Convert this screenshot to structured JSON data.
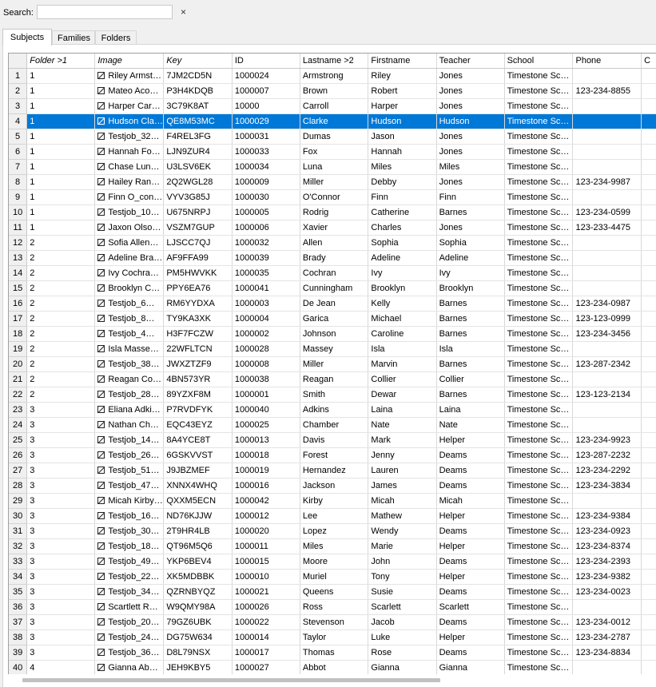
{
  "search": {
    "label": "Search:",
    "value": "",
    "placeholder": "",
    "clear_icon": "×"
  },
  "tabs": [
    {
      "label": "Subjects",
      "active": true
    },
    {
      "label": "Families",
      "active": false
    },
    {
      "label": "Folders",
      "active": false
    }
  ],
  "columns": [
    "Folder >1",
    "Image",
    "Key",
    "ID",
    "Lastname >2",
    "Firstname",
    "Teacher",
    "School",
    "Phone",
    "C"
  ],
  "italic_columns": [
    0,
    1,
    2
  ],
  "selected_row": 4,
  "colors": {
    "selection": "#0078d7"
  },
  "rows": [
    [
      "1",
      "Riley Armst…",
      "7JM2CD5N",
      "1000024",
      "Armstrong",
      "Riley",
      "Jones",
      "Timestone Sc…",
      ""
    ],
    [
      "1",
      "Mateo Aco…",
      "P3H4KDQB",
      "1000007",
      "Brown",
      "Robert",
      "Jones",
      "Timestone Sc…",
      "123-234-8855"
    ],
    [
      "1",
      "Harper Car…",
      "3C79K8AT",
      "10000",
      "Carroll",
      "Harper",
      "Jones",
      "Timestone Sc…",
      ""
    ],
    [
      "1",
      "Hudson Cla…",
      "QE8M53MC",
      "1000029",
      "Clarke",
      "Hudson",
      "Hudson",
      "Timestone Sc…",
      ""
    ],
    [
      "1",
      "Testjob_32…",
      "F4REL3FG",
      "1000031",
      "Dumas",
      "Jason",
      "Jones",
      "Timestone Sc…",
      ""
    ],
    [
      "1",
      "Hannah Fo…",
      "LJN9ZUR4",
      "1000033",
      "Fox",
      "Hannah",
      "Jones",
      "Timestone Sc…",
      ""
    ],
    [
      "1",
      "Chase Lun…",
      "U3LSV6EK",
      "1000034",
      "Luna",
      "Miles",
      "Miles",
      "Timestone Sc…",
      ""
    ],
    [
      "1",
      "Hailey Ran…",
      "2Q2WGL28",
      "1000009",
      "Miller",
      "Debby",
      "Jones",
      "Timestone Sc…",
      "123-234-9987"
    ],
    [
      "1",
      "Finn O_con…",
      "VYV3G85J",
      "1000030",
      "O'Connor",
      "Finn",
      "Finn",
      "Timestone Sc…",
      ""
    ],
    [
      "1",
      "Testjob_10…",
      "U675NRPJ",
      "1000005",
      "Rodrig",
      "Catherine",
      " Barnes",
      "Timestone Sc…",
      "123-234-0599"
    ],
    [
      "1",
      "Jaxon Olso…",
      "VSZM7GUP",
      "1000006",
      "Xavier",
      "Charles",
      "Jones",
      "Timestone Sc…",
      "123-233-4475"
    ],
    [
      "2",
      "Sofia Allen…",
      "LJSCC7QJ",
      "1000032",
      "Allen",
      "Sophia",
      "Sophia",
      "Timestone Sc…",
      ""
    ],
    [
      "2",
      "Adeline Bra…",
      "AF9FFA99",
      "1000039",
      "Brady",
      "Adeline",
      "Adeline",
      "Timestone Sc…",
      ""
    ],
    [
      "2",
      "Ivy Cochra…",
      "PM5HWVKK",
      "1000035",
      "Cochran",
      "Ivy",
      "Ivy",
      "Timestone Sc…",
      ""
    ],
    [
      "2",
      "Brooklyn C…",
      "PPY6EA76",
      "1000041",
      "Cunningham",
      "Brooklyn",
      "Brooklyn",
      "Timestone Sc…",
      ""
    ],
    [
      "2",
      "Testjob_6…",
      "RM6YYDXA",
      "1000003",
      "De Jean",
      "Kelly",
      " Barnes",
      "Timestone Sc…",
      "123-234-0987"
    ],
    [
      "2",
      "Testjob_8…",
      "TY9KA3XK",
      "1000004",
      "Garica",
      "Michael",
      " Barnes",
      "Timestone Sc…",
      "123-123-0999"
    ],
    [
      "2",
      "Testjob_4…",
      "H3F7FCZW",
      "1000002",
      "Johnson",
      "Caroline",
      " Barnes",
      "Timestone Sc…",
      "123-234-3456"
    ],
    [
      "2",
      "Isla Masse…",
      "22WFLTCN",
      "1000028",
      "Massey",
      "Isla",
      "Isla",
      "Timestone Sc…",
      ""
    ],
    [
      "2",
      "Testjob_38…",
      "JWXZTZF9",
      "1000008",
      "Miller",
      "Marvin",
      " Barnes",
      "Timestone Sc…",
      "123-287-2342"
    ],
    [
      "2",
      "Reagan Co…",
      "4BN573YR",
      "1000038",
      "Reagan",
      "Collier",
      "Collier",
      "Timestone Sc…",
      ""
    ],
    [
      "2",
      "Testjob_28…",
      "89YZXF8M",
      "1000001",
      "Smith",
      "Dewar",
      " Barnes",
      "Timestone Sc…",
      "123-123-2134"
    ],
    [
      "3",
      "Eliana Adki…",
      "P7RVDFYK",
      "1000040",
      "Adkins",
      "Laina",
      "Laina",
      "Timestone Sc…",
      ""
    ],
    [
      "3",
      "Nathan Ch…",
      "EQC43EYZ",
      "1000025",
      "Chamber",
      "Nate",
      "Nate",
      "Timestone Sc…",
      ""
    ],
    [
      "3",
      "Testjob_14…",
      "8A4YCE8T",
      "1000013",
      "Davis",
      "Mark",
      "Helper",
      "Timestone Sc…",
      "123-234-9923"
    ],
    [
      "3",
      "Testjob_26…",
      "6GSKVVST",
      "1000018",
      "Forest",
      "Jenny",
      "Deams",
      "Timestone Sc…",
      "123-287-2232"
    ],
    [
      "3",
      "Testjob_51…",
      "J9JBZMEF",
      "1000019",
      "Hernandez",
      "Lauren",
      "Deams",
      "Timestone Sc…",
      "123-234-2292"
    ],
    [
      "3",
      "Testjob_47…",
      "XNNX4WHQ",
      "1000016",
      "Jackson",
      "James",
      "Deams",
      "Timestone Sc…",
      "123-234-3834"
    ],
    [
      "3",
      "Micah Kirby…",
      "QXXM5ECN",
      "1000042",
      "Kirby",
      "Micah",
      "Micah",
      "Timestone Sc…",
      ""
    ],
    [
      "3",
      "Testjob_16…",
      "ND76KJJW",
      "1000012",
      "Lee",
      "Mathew",
      "Helper",
      "Timestone Sc…",
      "123-234-9384"
    ],
    [
      "3",
      "Testjob_30…",
      "2T9HR4LB",
      "1000020",
      "Lopez",
      "Wendy",
      "Deams",
      "Timestone Sc…",
      "123-234-0923"
    ],
    [
      "3",
      "Testjob_18…",
      "QT96M5Q6",
      "1000011",
      "Miles",
      "Marie",
      "Helper",
      "Timestone Sc…",
      "123-234-8374"
    ],
    [
      "3",
      "Testjob_49…",
      "YKP6BEV4",
      "1000015",
      "Moore",
      "John",
      "Deams",
      "Timestone Sc…",
      "123-234-2393"
    ],
    [
      "3",
      "Testjob_22…",
      "XK5MDBBK",
      "1000010",
      "Muriel",
      "Tony",
      "Helper",
      "Timestone Sc…",
      "123-234-9382"
    ],
    [
      "3",
      "Testjob_34…",
      "QZRNBYQZ",
      "1000021",
      "Queens",
      "Susie",
      "Deams",
      "Timestone Sc…",
      "123-234-0023"
    ],
    [
      "3",
      "Scartlett R…",
      "W9QMY98A",
      "1000026",
      "Ross",
      "Scarlett",
      "Scarlett",
      "Timestone Sc…",
      ""
    ],
    [
      "3",
      "Testjob_20…",
      "79GZ6UBK",
      "1000022",
      "Stevenson",
      "Jacob",
      "Deams",
      "Timestone Sc…",
      "123-234-0012"
    ],
    [
      "3",
      "Testjob_24…",
      "DG75W634",
      "1000014",
      "Taylor",
      "Luke",
      "Helper",
      "Timestone Sc…",
      "123-234-2787"
    ],
    [
      "3",
      "Testjob_36…",
      "D8L79NSX",
      "1000017",
      "Thomas",
      "Rose",
      "Deams",
      "Timestone Sc…",
      "123-234-8834"
    ],
    [
      "4",
      "Gianna Ab…",
      "JEH9KBY5",
      "1000027",
      "Abbot",
      "Gianna",
      "Gianna",
      "Timestone Sc…",
      ""
    ]
  ]
}
